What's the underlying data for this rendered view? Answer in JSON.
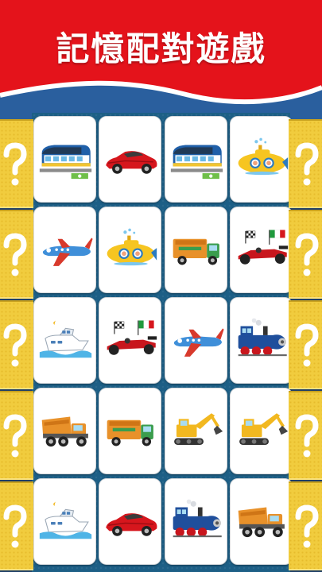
{
  "title": "記憶配對遊戲",
  "colors": {
    "header_red": "#e4131b",
    "header_blue": "#2a5f9e",
    "side_yellow": "#f1cc3e",
    "board_blue": "#1d5f86"
  },
  "side_icons": "question-mark-icon",
  "board": {
    "columns": 4,
    "rows": 5,
    "cards": [
      {
        "icon": "bullet-train"
      },
      {
        "icon": "red-sports-car"
      },
      {
        "icon": "bullet-train"
      },
      {
        "icon": "yellow-submarine"
      },
      {
        "icon": "blue-airplane"
      },
      {
        "icon": "yellow-submarine"
      },
      {
        "icon": "garbage-truck"
      },
      {
        "icon": "race-car-italy-flag"
      },
      {
        "icon": "speedboat"
      },
      {
        "icon": "race-car-italy-flag"
      },
      {
        "icon": "blue-airplane"
      },
      {
        "icon": "steam-locomotive"
      },
      {
        "icon": "dump-truck"
      },
      {
        "icon": "garbage-truck"
      },
      {
        "icon": "excavator"
      },
      {
        "icon": "excavator"
      },
      {
        "icon": "speedboat"
      },
      {
        "icon": "red-sports-car"
      },
      {
        "icon": "steam-locomotive"
      },
      {
        "icon": "dump-truck"
      }
    ]
  }
}
